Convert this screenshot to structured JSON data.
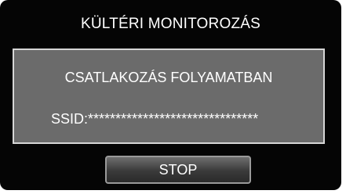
{
  "screen": {
    "title": "KÜLTÉRI MONITOROZÁS",
    "status_text": "CSATLAKOZÁS FOLYAMATBAN",
    "ssid_line": "SSID:*******************************",
    "stop_label": "STOP"
  },
  "colors": {
    "background": "#050505",
    "panel": "#6b6b6b",
    "panel_border": "#d6d6d6",
    "text": "#ffffff"
  }
}
